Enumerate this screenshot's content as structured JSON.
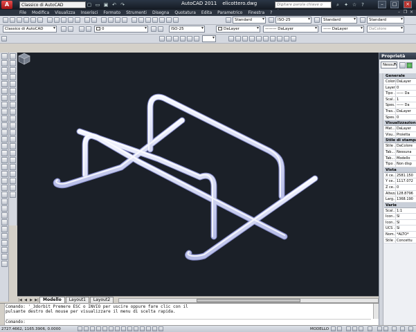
{
  "titlebar": {
    "app_icon": "A",
    "workspace": "Classico di AutoCAD",
    "app_name": "AutoCAD 2011",
    "file_name": "elicottero.dwg",
    "help_placeholder": "Digitare parola chiave o frase"
  },
  "menu": {
    "items": [
      "File",
      "Modifica",
      "Visualizza",
      "Inserisci",
      "Formato",
      "Strumenti",
      "Disegna",
      "Quotatura",
      "Edita",
      "Parametrico",
      "Finestra",
      "?"
    ]
  },
  "toolbar2": {
    "text_style": "Standard",
    "dim_style": "ISO-25",
    "table_style": "Standard",
    "mleader_style": "Standard"
  },
  "toolbar3": {
    "workspace": "Classico di AutoCAD",
    "layer": "0",
    "dim_style2": "ISO-25",
    "color": "DaLayer",
    "linetype": "DaLayer",
    "lineweight": "DaLayer",
    "plot_style": "DaColore"
  },
  "tabs": [
    "Modello",
    "Layout1",
    "Layout2"
  ],
  "command": {
    "history_line1": "Comando: '_3dorbit Premere ESC o INVIO per uscire oppure fare clic con il",
    "history_line2": "pulsante destro del mouse per visualizzare il menu di scelta rapida.",
    "prompt": "Comando:"
  },
  "status": {
    "coordinates": "2727.4662, 1165.3906, 0.0000",
    "model": "MODELLO"
  },
  "properties": {
    "title": "Proprietà",
    "selection": "Nessuna",
    "sections": [
      {
        "name": "Generale",
        "rows": [
          {
            "k": "Colore",
            "v": "DaLayer"
          },
          {
            "k": "Layer",
            "v": "0"
          },
          {
            "k": "Tipo ...",
            "v": "—— Da"
          },
          {
            "k": "Scal...",
            "v": "1"
          },
          {
            "k": "Spes...",
            "v": "—— Da"
          },
          {
            "k": "Tras...",
            "v": "DaLayer"
          },
          {
            "k": "Spes...",
            "v": "0"
          }
        ]
      },
      {
        "name": "Visualizzazion...",
        "rows": [
          {
            "k": "Mat...",
            "v": "DaLayer"
          },
          {
            "k": "Visu...",
            "v": "Proietta"
          }
        ]
      },
      {
        "name": "Stile di stampa",
        "rows": [
          {
            "k": "Stile ...",
            "v": "DaColore"
          },
          {
            "k": "Tab...",
            "v": "Nessuna"
          },
          {
            "k": "Tab...",
            "v": "Modello"
          },
          {
            "k": "Tipo ...",
            "v": "Non disp"
          }
        ]
      },
      {
        "name": "Vista",
        "rows": [
          {
            "k": "X ce...",
            "v": "2581.150"
          },
          {
            "k": "Y ce...",
            "v": "1117.072"
          },
          {
            "k": "Z ce...",
            "v": "0"
          },
          {
            "k": "Altezza",
            "v": "128.8796"
          },
          {
            "k": "Larg...",
            "v": "1368.190"
          }
        ]
      },
      {
        "name": "Varie",
        "rows": [
          {
            "k": "Scal...",
            "v": "1:1"
          },
          {
            "k": "Icon...",
            "v": "Sì"
          },
          {
            "k": "Icon...",
            "v": "Sì"
          },
          {
            "k": "UCS ...",
            "v": "Sì"
          },
          {
            "k": "Nom...",
            "v": "*ALTO*"
          },
          {
            "k": "Stile ...",
            "v": "Concettu"
          }
        ]
      }
    ]
  },
  "colors": {
    "canvas": "#1b2028",
    "tube": "#d8dcf4",
    "tube_edge": "#8a90c8"
  },
  "icons": {
    "drawing_tools": [
      "line-icon",
      "xline-icon",
      "polyline-icon",
      "polygon-icon",
      "rectangle-icon",
      "arc-icon",
      "circle-icon",
      "spline-icon",
      "ellipse-icon",
      "insert-block-icon",
      "point-icon",
      "hatch-icon",
      "region-icon",
      "table-icon",
      "mtext-icon"
    ],
    "view_cube": "view-cube-icon"
  }
}
